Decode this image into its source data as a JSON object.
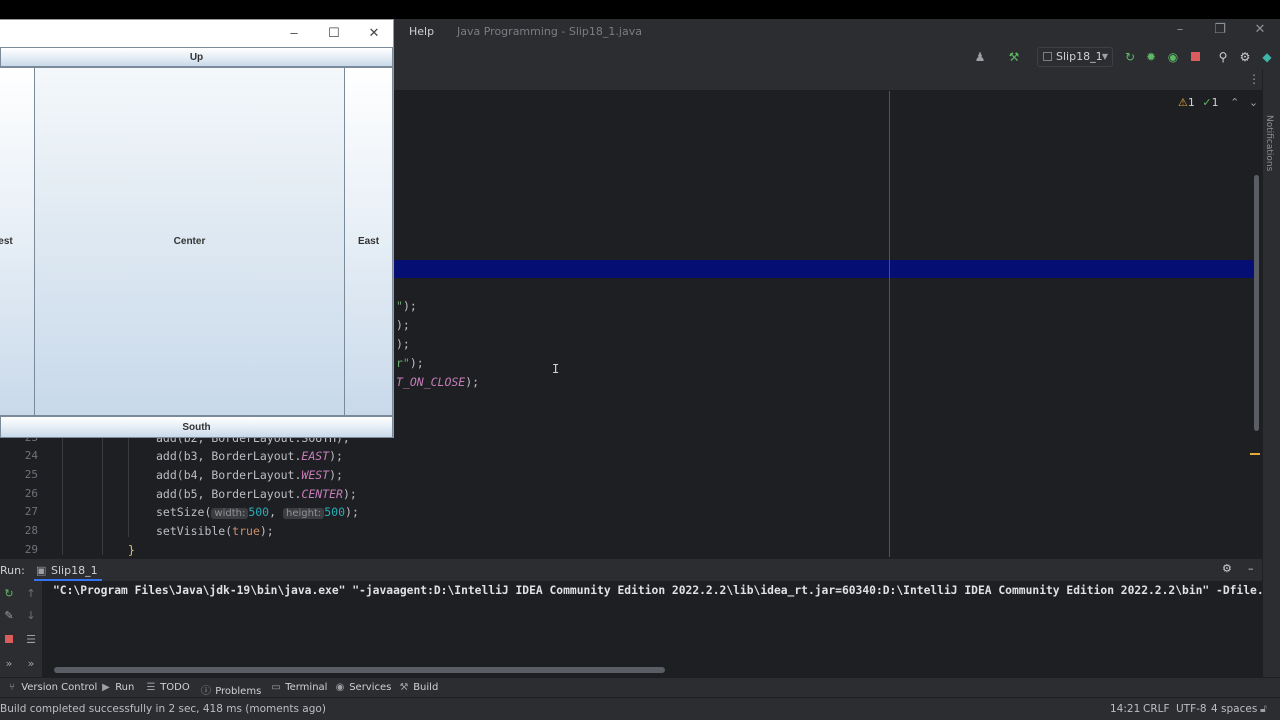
{
  "ide": {
    "menu_help": "Help",
    "title": "Java Programming - Slip18_1.java",
    "run_config": "Slip18_1",
    "problems_indicator": {
      "warnings": "1",
      "checks": "1"
    },
    "notifications_label": "Notifications"
  },
  "editor": {
    "code_fragments": [
      {
        "text": "\");",
        "top": 0
      },
      {
        "text": ");",
        "top": 0
      },
      {
        "text": ");",
        "top": 0
      },
      {
        "text": "r\");",
        "top": 0
      },
      {
        "text": "T_ON_CLOSE);",
        "top": 0
      }
    ],
    "lines": [
      {
        "num": "23"
      },
      {
        "num": "24",
        "pre": "add(b3, BorderLayout.",
        "const": "EAST",
        "post": ");"
      },
      {
        "num": "25",
        "pre": "add(b4, BorderLayout.",
        "const": "WEST",
        "post": ");"
      },
      {
        "num": "26",
        "pre": "add(b5, BorderLayout.",
        "const": "CENTER",
        "post": ");"
      },
      {
        "num": "27",
        "pre": "setSize(",
        "hint1": "width:",
        "val1": "500",
        "mid": ",",
        "hint2": "height:",
        "val2": "500",
        "post": ");"
      },
      {
        "num": "28",
        "pre": "setVisible(",
        "kw": "true",
        "post": ");"
      },
      {
        "num": "29",
        "brace": "}"
      }
    ],
    "line23_partial": "add(b2, BorderLayout.SOUTH);"
  },
  "run_panel": {
    "label": "Run:",
    "tab": "Slip18_1",
    "console_line": "\"C:\\Program Files\\Java\\jdk-19\\bin\\java.exe\" \"-javaagent:D:\\IntelliJ IDEA Community Edition 2022.2.2\\lib\\idea_rt.jar=60340:D:\\IntelliJ IDEA Community Edition 2022.2.2\\bin\" -Dfile."
  },
  "tool_tabs": [
    {
      "label": "Version Control",
      "icon": "branch-icon"
    },
    {
      "label": "Run",
      "icon": "play-icon"
    },
    {
      "label": "TODO",
      "icon": "list-icon"
    },
    {
      "label": "Problems",
      "icon": "info-icon"
    },
    {
      "label": "Terminal",
      "icon": "terminal-icon"
    },
    {
      "label": "Services",
      "icon": "services-icon"
    },
    {
      "label": "Build",
      "icon": "hammer-icon"
    }
  ],
  "status_bar": {
    "message": "Build completed successfully in 2 sec, 418 ms (moments ago)",
    "position": "14:21",
    "line_sep": "CRLF",
    "encoding": "UTF-8",
    "indent": "4 spaces"
  },
  "swing_window": {
    "buttons": {
      "north": "Up",
      "west": "West",
      "center": "Center",
      "east": "East",
      "south": "South"
    }
  },
  "colors": {
    "ide_bg": "#1e1f22",
    "panel_bg": "#2b2d30",
    "selection_band": "#050e73",
    "run_green": "#5fb865",
    "stop_red": "#db5c5c"
  }
}
